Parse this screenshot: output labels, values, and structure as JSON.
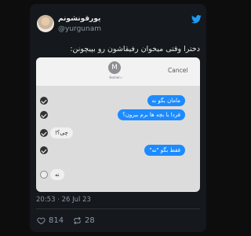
{
  "tweet": {
    "display_name": "یورقونشونم",
    "handle": "@yurgunam",
    "text": "دخترا وقتی میخوان رفیقاشون رو بپیچونن:",
    "timestamp": "20:53 · 26 Jul 23",
    "likes": "814",
    "retweets": "28",
    "icons": [
      "twitter-bird-icon",
      "heart-icon",
      "retweet-icon"
    ],
    "brand_color": "#1d9bf0"
  },
  "screenshot": {
    "contact_initial": "M",
    "contact_name": "Hamen ›",
    "cancel_label": "Cancel",
    "messages": [
      {
        "text": "مامان بگو نه",
        "direction": "outgoing",
        "selected": true
      },
      {
        "text": "فردا با بچه ها برم بیرون؟",
        "direction": "outgoing",
        "selected": true
      },
      {
        "text": "چی؟!",
        "direction": "incoming",
        "selected": true
      },
      {
        "text": "فقط بگو \"نه\"",
        "direction": "outgoing",
        "selected": true
      },
      {
        "text": "نه",
        "direction": "incoming",
        "selected": false
      }
    ],
    "bubble_color": "#1d8bff"
  }
}
